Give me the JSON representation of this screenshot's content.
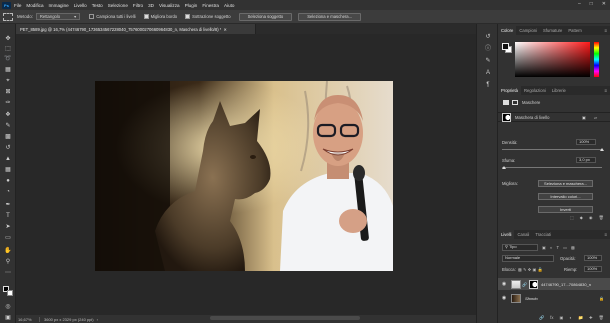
{
  "menubar": {
    "logo": "Ps",
    "items": [
      "File",
      "Modifica",
      "Immagine",
      "Livello",
      "Testo",
      "Selezione",
      "Filtro",
      "3D",
      "Visualizza",
      "Plugin",
      "Finestra",
      "Aiuto"
    ]
  },
  "options": {
    "method_label": "Metodo:",
    "method_value": "Rettangolo",
    "sample_all": "Campiona tutti i livelli",
    "enhance_edge": "Migliora bordo",
    "subtract": "Sottrazione soggetto",
    "select_subject": "Seleziona soggetto",
    "select_mask": "Seleziona e maschera..."
  },
  "document": {
    "tab_title": "PET_8589.jpg @ 16,7% (44746790_1736534567228040_7576000270660964830_n, Maschera di livello/8) *",
    "zoom": "16,67%",
    "size": "3600 px x 2329 px (240 ppi)"
  },
  "color_panel": {
    "tabs": [
      "Colore",
      "Campioni",
      "Sfumature",
      "Pattern"
    ]
  },
  "properties_panel": {
    "tabs": [
      "Proprietà",
      "Regolazioni",
      "Librerie"
    ],
    "subheader": "Maschere",
    "mask_label": "Maschera di livello",
    "density_label": "Densità:",
    "density_value": "100%",
    "feather_label": "Sfuma:",
    "feather_value": "3,0 px",
    "refine_label": "Migliora:",
    "btn_select_mask": "Seleziona e maschera...",
    "btn_color_range": "Intervallo colori...",
    "btn_invert": "Inverti"
  },
  "layers_panel": {
    "tabs": [
      "Livelli",
      "Canali",
      "Tracciati"
    ],
    "filter_kind": "Tipo",
    "blend_mode": "Normale",
    "opacity_label": "Opacità:",
    "opacity_value": "100%",
    "lock_label": "Blocca:",
    "fill_label": "Riemp:",
    "fill_value": "100%",
    "layers": [
      {
        "name": "44746790_17...70864830_n",
        "selected": true
      },
      {
        "name": "Sfondo",
        "selected": false
      }
    ]
  }
}
